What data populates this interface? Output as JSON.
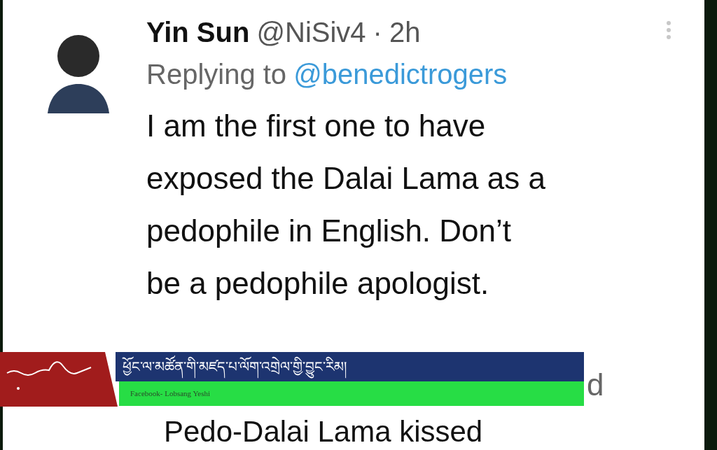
{
  "tweet": {
    "name": "Yin Sun",
    "handle": "@NiSiv4",
    "separator": "·",
    "time": "2h",
    "replying_prefix": "Replying to",
    "replying_to": "@benedictrogers",
    "lines": [
      "I am the first one to have",
      "exposed the Dalai Lama as a",
      "pedophile in English. Don’t",
      "be a pedophile apologist."
    ]
  },
  "quoted": {
    "partial_text": "d",
    "text": "Pedo-Dalai Lama kissed"
  },
  "banner": {
    "headline": "ཕྱོང་ལ་མཚོན་གི་མཛད་པ་ལོག་འགྲེལ་གྱི་བྱུང་རིམ།",
    "source": "Facebook- Lobsang Yeshi"
  }
}
